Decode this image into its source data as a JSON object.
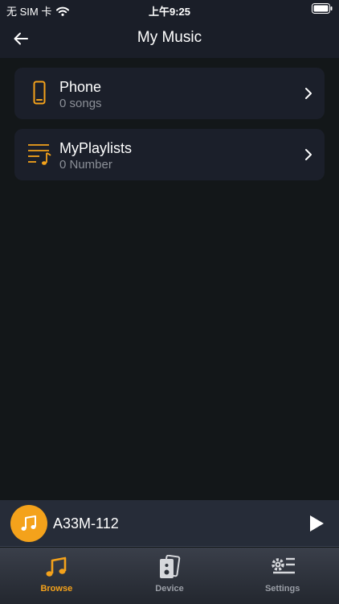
{
  "status_bar": {
    "carrier": "无 SIM 卡",
    "time": "上午9:25"
  },
  "nav": {
    "title": "My Music",
    "back_icon": "arrow-left-icon"
  },
  "list": [
    {
      "title": "Phone",
      "subtitle": "0 songs",
      "icon": "phone-icon"
    },
    {
      "title": "MyPlaylists",
      "subtitle": "0 Number",
      "icon": "playlist-icon"
    }
  ],
  "mini_player": {
    "title": "A33M-112",
    "art_icon": "music-note-icon",
    "play_icon": "play-icon"
  },
  "tabs": [
    {
      "label": "Browse",
      "icon": "music-note-icon",
      "active": true
    },
    {
      "label": "Device",
      "icon": "device-icon",
      "active": false
    },
    {
      "label": "Settings",
      "icon": "settings-icon",
      "active": false
    }
  ],
  "colors": {
    "accent": "#f4a21b",
    "background": "#131719",
    "card": "#1b1f2a",
    "bar": "#1a1e28",
    "muted_text": "#8b8f97"
  }
}
